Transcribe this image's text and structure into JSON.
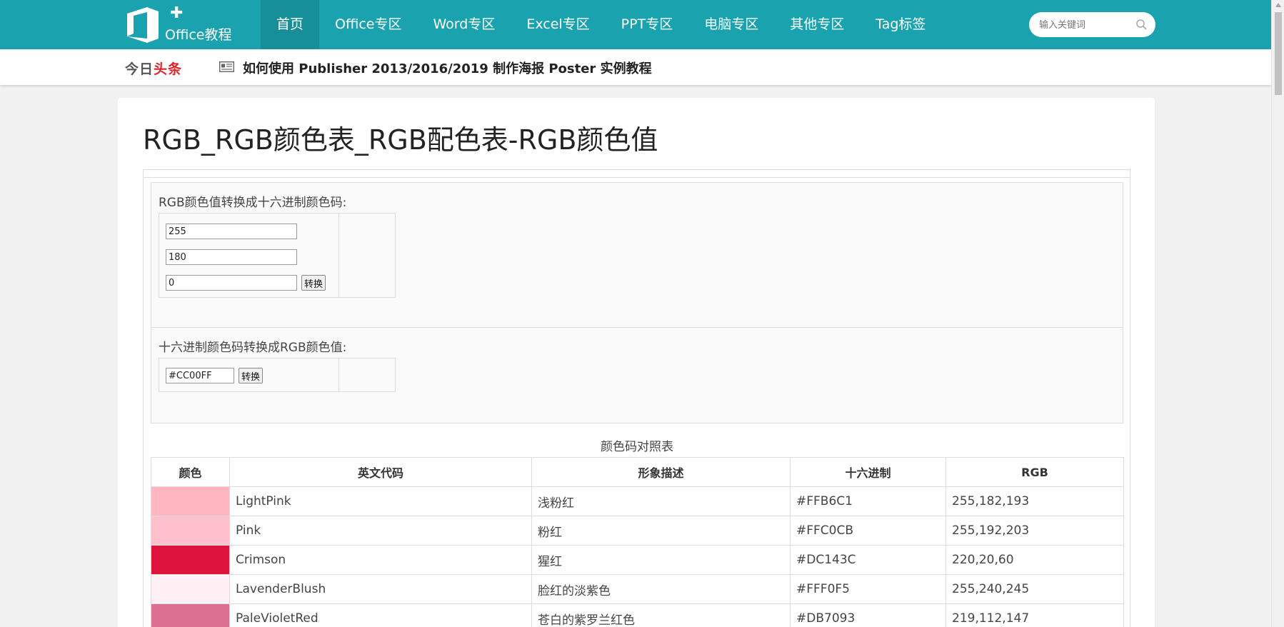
{
  "logo": {
    "text": "Office教程"
  },
  "nav": [
    {
      "label": "首页",
      "active": true
    },
    {
      "label": "Office专区"
    },
    {
      "label": "Word专区"
    },
    {
      "label": "Excel专区"
    },
    {
      "label": "PPT专区"
    },
    {
      "label": "电脑专区"
    },
    {
      "label": "其他专区"
    },
    {
      "label": "Tag标签"
    }
  ],
  "search": {
    "placeholder": "输入关键词",
    "icon": "search-icon"
  },
  "headline_bar": {
    "today_prefix": "今日",
    "today_suffix": "头条",
    "icon": "news-icon",
    "headline": "如何使用 Publisher 2013/2016/2019 制作海报 Poster 实例教程"
  },
  "page": {
    "title": "RGB_RGB颜色表_RGB配色表-RGB颜色值"
  },
  "rgb_to_hex": {
    "label": "RGB颜色值转换成十六进制颜色码:",
    "r": "255",
    "g": "180",
    "b": "0",
    "button": "转换"
  },
  "hex_to_rgb": {
    "label": "十六进制颜色码转换成RGB颜色值:",
    "hex": "#CC00FF",
    "button": "转换"
  },
  "color_table": {
    "caption": "颜色码对照表",
    "headers": [
      "颜色",
      "英文代码",
      "形象描述",
      "十六进制",
      "RGB"
    ],
    "rows": [
      {
        "color": "#FFB6C1",
        "name": "LightPink",
        "desc": "浅粉红",
        "hex": "#FFB6C1",
        "rgb": "255,182,193"
      },
      {
        "color": "#FFC0CB",
        "name": "Pink",
        "desc": "粉红",
        "hex": "#FFC0CB",
        "rgb": "255,192,203"
      },
      {
        "color": "#DC143C",
        "name": "Crimson",
        "desc": "猩红",
        "hex": "#DC143C",
        "rgb": "220,20,60"
      },
      {
        "color": "#FFF0F5",
        "name": "LavenderBlush",
        "desc": "脸红的淡紫色",
        "hex": "#FFF0F5",
        "rgb": "255,240,245"
      },
      {
        "color": "#DB7093",
        "name": "PaleVioletRed",
        "desc": "苍白的紫罗兰红色",
        "hex": "#DB7093",
        "rgb": "219,112,147"
      }
    ]
  },
  "colors": {
    "topbar": "#1aa3ae",
    "nav_active": "#168f99",
    "headline_red": "#d9252b"
  }
}
